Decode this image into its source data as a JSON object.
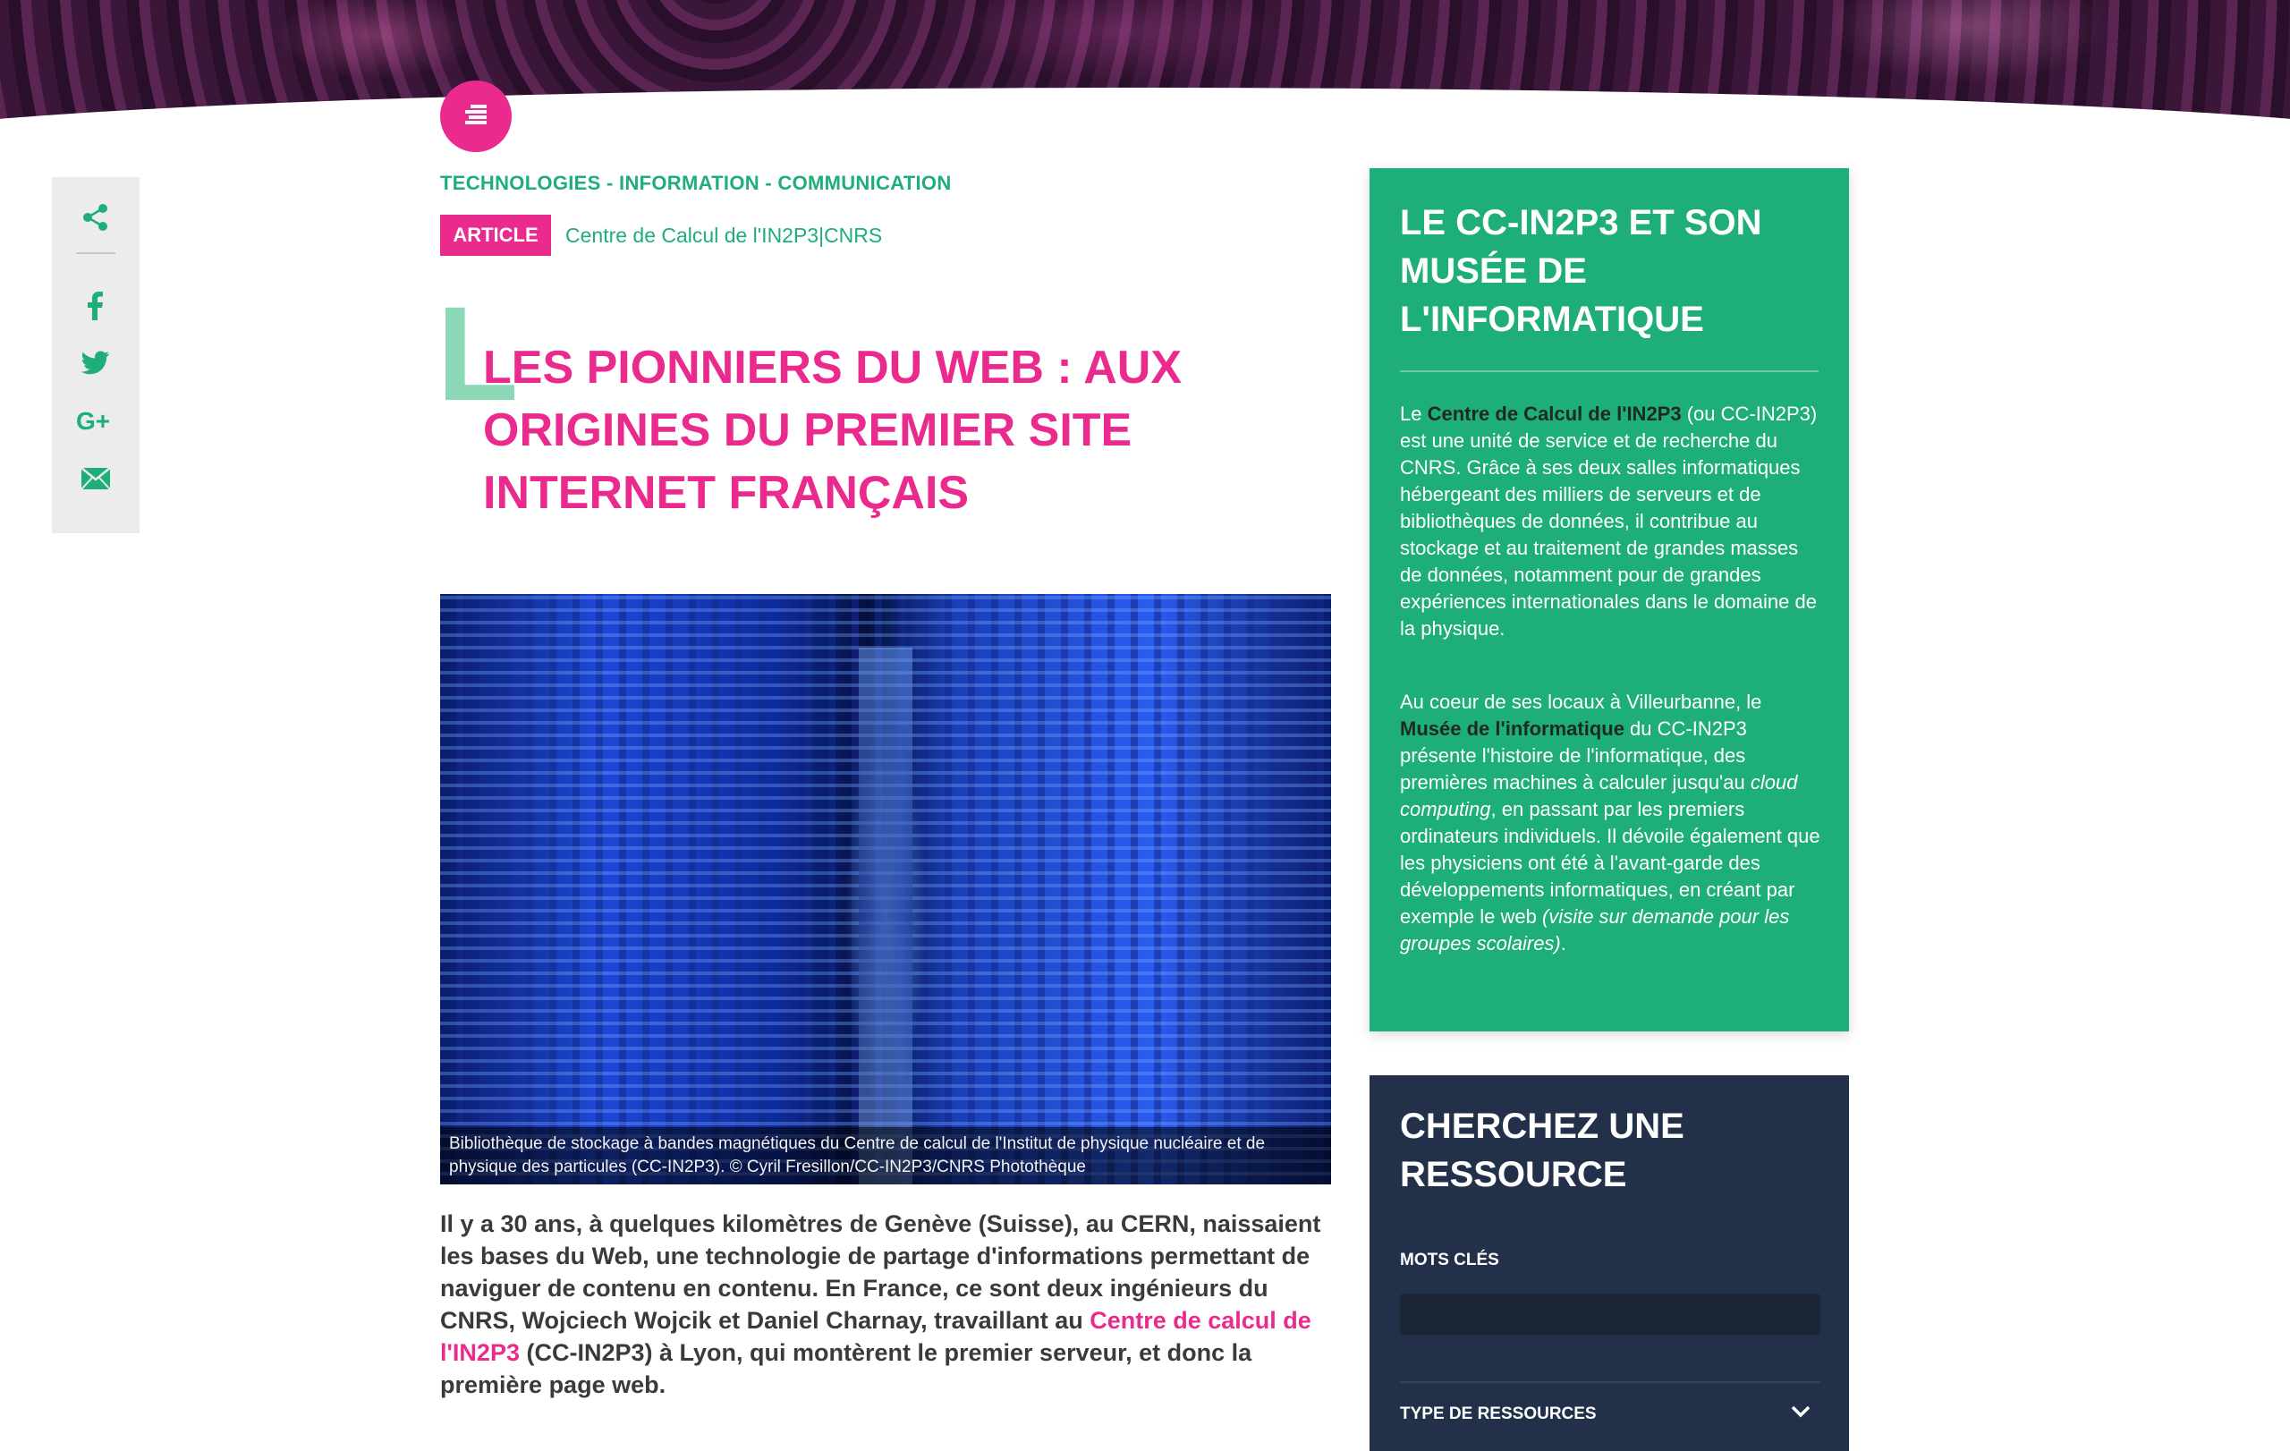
{
  "categories": "TECHNOLOGIES - INFORMATION - COMMUNICATION",
  "tag": "ARTICLE",
  "source": "Centre de Calcul de l'IN2P3|CNRS",
  "dropcap": "L",
  "title": "LES PIONNIERS DU WEB : AUX ORIGINES DU PREMIER SITE INTERNET FRANÇAIS",
  "figure": {
    "caption": "Bibliothèque de stockage à bandes magnétiques du Centre de calcul de l'Institut de physique nucléaire et de physique des particules (CC-IN2P3). © Cyril Fresillon/CC-IN2P3/CNRS Photothèque"
  },
  "intro": {
    "part1": "Il y a 30 ans, à quelques kilomètres de Genève (Suisse), au CERN, naissaient les bases du Web, une technologie de partage d'informations permettant de naviguer de contenu en contenu. En France, ce sont deux ingénieurs du CNRS, Wojciech Wojcik et Daniel Charnay, travaillant au ",
    "link": "Centre de calcul de l'IN2P3",
    "part2": " (CC-IN2P3) à Lyon, qui montèrent le premier serveur, et donc la première page web."
  },
  "share": {
    "icons": [
      "share-icon",
      "facebook-icon",
      "twitter-icon",
      "google-plus-icon",
      "email-icon"
    ]
  },
  "aside_green": {
    "title": "LE CC-IN2P3 ET SON MUSÉE DE L'INFORMATIQUE",
    "p1_a": "Le ",
    "p1_link": "Centre de Calcul de l'IN2P3",
    "p1_b": " (ou CC-IN2P3) est une unité de service et de recherche du CNRS. Grâce à ses deux salles informatiques hébergeant des milliers de serveurs et de bibliothèques de données, il contribue au stockage et au traitement de grandes masses de données, notamment pour de grandes expériences internationales dans le domaine de la physique.",
    "p2_a": "Au coeur de ses locaux à Villeurbanne, le ",
    "p2_link": "Musée de l'informatique",
    "p2_b": " du CC-IN2P3 présente l'histoire de l'informatique, des premières machines à calculer jusqu'au ",
    "p2_em": "cloud computing",
    "p2_c": ", en passant par les premiers ordinateurs individuels. Il dévoile également que les physiciens ont été à l'avant-garde des développements informatiques, en créant par exemple le web ",
    "p2_em2": "(visite sur demande pour les groupes scolaires)",
    "p2_d": "."
  },
  "aside_dark": {
    "title": "CHERCHEZ UNE RESSOURCE",
    "keywords_label": "MOTS CLÉS",
    "keywords_value": "",
    "type_label": "TYPE DE RESSOURCES"
  },
  "colors": {
    "accent_pink": "#ea2a8d",
    "accent_green": "#1eae78",
    "dark_panel": "#22304a"
  }
}
